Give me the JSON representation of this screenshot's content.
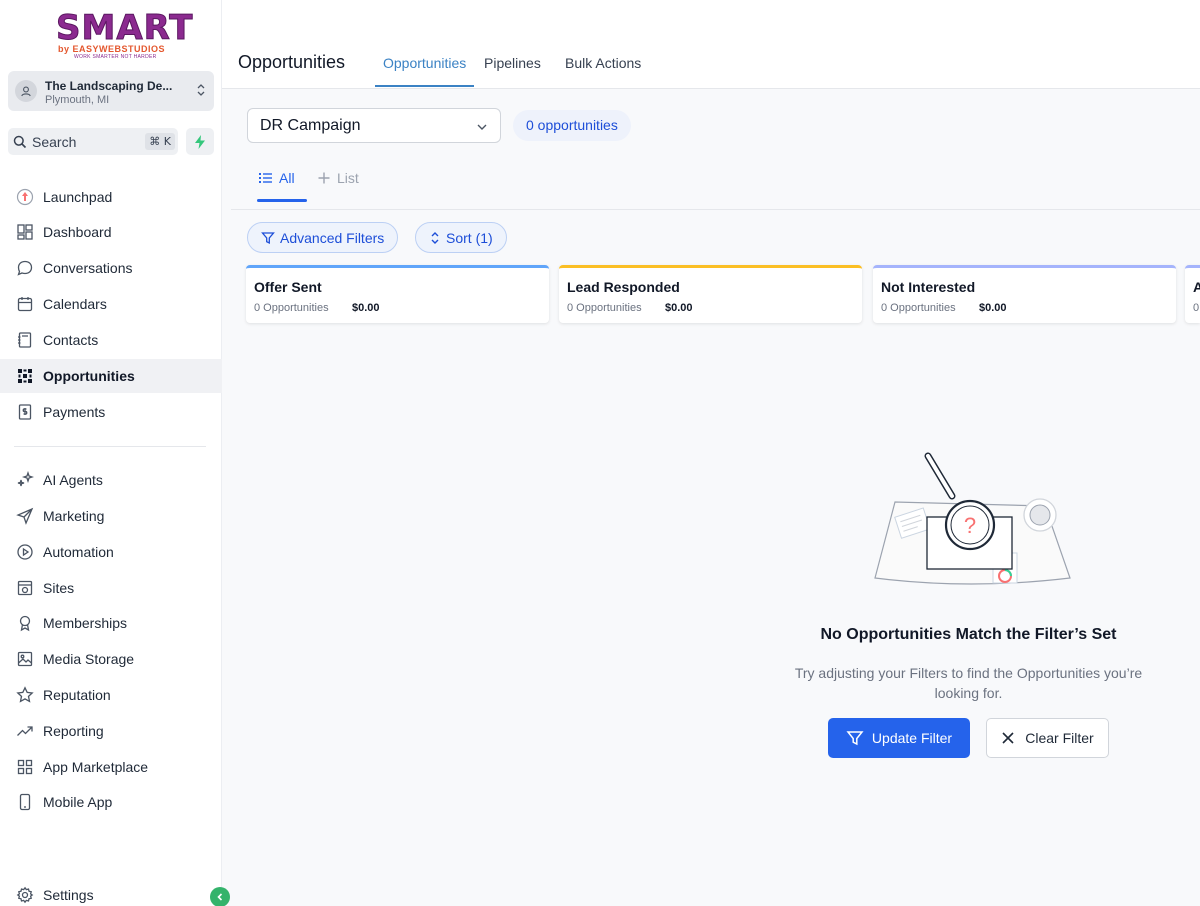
{
  "brand": {
    "logo_main": "SMART",
    "logo_sub": "by EASYWEBSTUDIOS",
    "logo_tagline": "WORK SMARTER NOT HARDER"
  },
  "location": {
    "name": "The Landscaping De...",
    "city": "Plymouth, MI"
  },
  "search": {
    "label": "Search",
    "shortcut": "⌘ K"
  },
  "nav": {
    "launchpad": "Launchpad",
    "dashboard": "Dashboard",
    "conversations": "Conversations",
    "calendars": "Calendars",
    "contacts": "Contacts",
    "opportunities": "Opportunities",
    "payments": "Payments",
    "ai_agents": "AI Agents",
    "marketing": "Marketing",
    "automation": "Automation",
    "sites": "Sites",
    "memberships": "Memberships",
    "media_storage": "Media Storage",
    "reputation": "Reputation",
    "reporting": "Reporting",
    "app_marketplace": "App Marketplace",
    "mobile_app": "Mobile App",
    "settings": "Settings"
  },
  "header": {
    "title": "Opportunities",
    "tabs": [
      "Opportunities",
      "Pipelines",
      "Bulk Actions"
    ]
  },
  "pipeline": {
    "selected": "DR Campaign",
    "count_label": "0 opportunities"
  },
  "views": {
    "all": "All",
    "list": "List"
  },
  "filters": {
    "advanced": "Advanced Filters",
    "sort": "Sort (1)"
  },
  "stages": [
    {
      "name": "Offer Sent",
      "count": "0 Opportunities",
      "value": "$0.00",
      "color": "#60a5fa"
    },
    {
      "name": "Lead Responded",
      "count": "0 Opportunities",
      "value": "$0.00",
      "color": "#fbbf24"
    },
    {
      "name": "Not Interested",
      "count": "0 Opportunities",
      "value": "$0.00",
      "color": "#a5b4fc"
    },
    {
      "name": "A",
      "count": "0",
      "value": "",
      "color": "#a5b4fc"
    }
  ],
  "empty_state": {
    "title": "No Opportunities Match the Filter’s Set",
    "description": "Try adjusting your Filters to find the Opportunities you’re looking for.",
    "update_button": "Update Filter",
    "clear_button": "Clear Filter"
  },
  "colors": {
    "primary": "#2563eb",
    "tab_active": "#3b82c4",
    "success": "#34b36b"
  }
}
